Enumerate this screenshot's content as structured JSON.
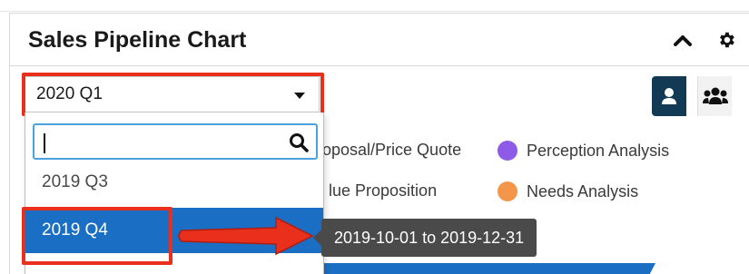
{
  "card": {
    "title": "Sales Pipeline Chart"
  },
  "timeperiod_select": {
    "value": "2020 Q1"
  },
  "dropdown": {
    "search_value": "",
    "options": [
      "2019 Q3",
      "2019 Q4"
    ],
    "highlighted_option": "2019 Q4"
  },
  "tooltip": {
    "text": "2019-10-01 to 2019-12-31"
  },
  "legend": {
    "items": [
      {
        "label": "oposal/Price Quote",
        "color": ""
      },
      {
        "label": "Perception Analysis",
        "color": "#8e5be8"
      },
      {
        "label": "lue Proposition",
        "color": ""
      },
      {
        "label": "Needs Analysis",
        "color": "#f4964a"
      }
    ]
  },
  "colors": {
    "accent_blue": "#1a6fc4",
    "annotation_red": "#e8301c",
    "toggle_active": "#123a55",
    "tooltip_bg": "#4a4a4a"
  },
  "icons": {
    "collapse": "chevron-up-icon",
    "settings": "gear-icon",
    "select_caret": "caret-down-icon",
    "search": "search-icon",
    "user_toggle": "user-icon",
    "group_toggle": "users-icon"
  }
}
